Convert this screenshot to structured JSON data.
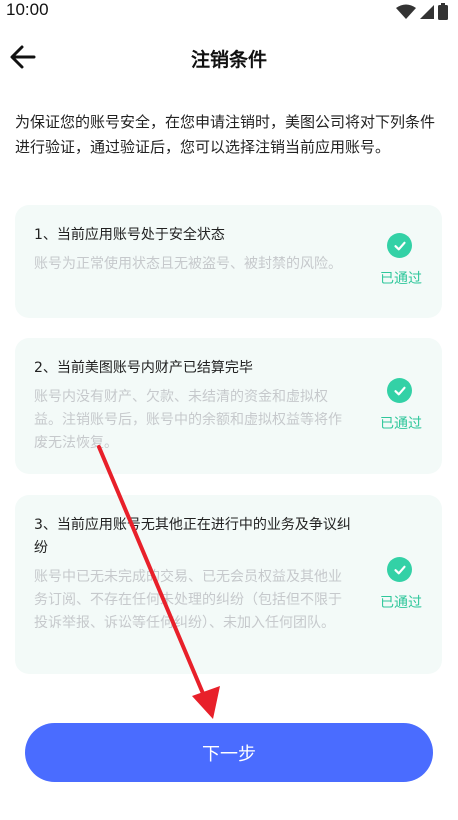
{
  "status_bar": {
    "time": "10:00",
    "icons": [
      "wifi-icon",
      "cellular-signal-icon",
      "battery-icon"
    ]
  },
  "header": {
    "title": "注销条件",
    "back_icon": "arrow-left-icon"
  },
  "intro": "为保证您的账号安全，在您申请注销时，美图公司将对下列条件进行验证，通过验证后，您可以选择注销当前应用账号。",
  "conditions": [
    {
      "title": "1、当前应用账号处于安全状态",
      "description": "账号为正常使用状态且无被盗号、被封禁的风险。",
      "status": "已通过"
    },
    {
      "title": "2、当前美图账号内财产已结算完毕",
      "description": "账号内没有财产、欠款、未结清的资金和虚拟权益。注销账号后，账号中的余额和虚拟权益等将作废无法恢复。",
      "status": "已通过"
    },
    {
      "title": "3、当前应用账号无其他正在进行中的业务及争议纠纷",
      "description": "账号中已无未完成的交易、已无会员权益及其他业务订阅、不存在任何未处理的纠纷（包括但不限于投诉举报、诉讼等任何纠纷）、未加入任何团队。",
      "status": "已通过"
    }
  ],
  "next_button": {
    "label": "下一步"
  },
  "colors": {
    "accent": "#4a6cff",
    "success": "#33d1a6",
    "card_background": "#f3faf8",
    "annotation_arrow": "#e8202a"
  }
}
